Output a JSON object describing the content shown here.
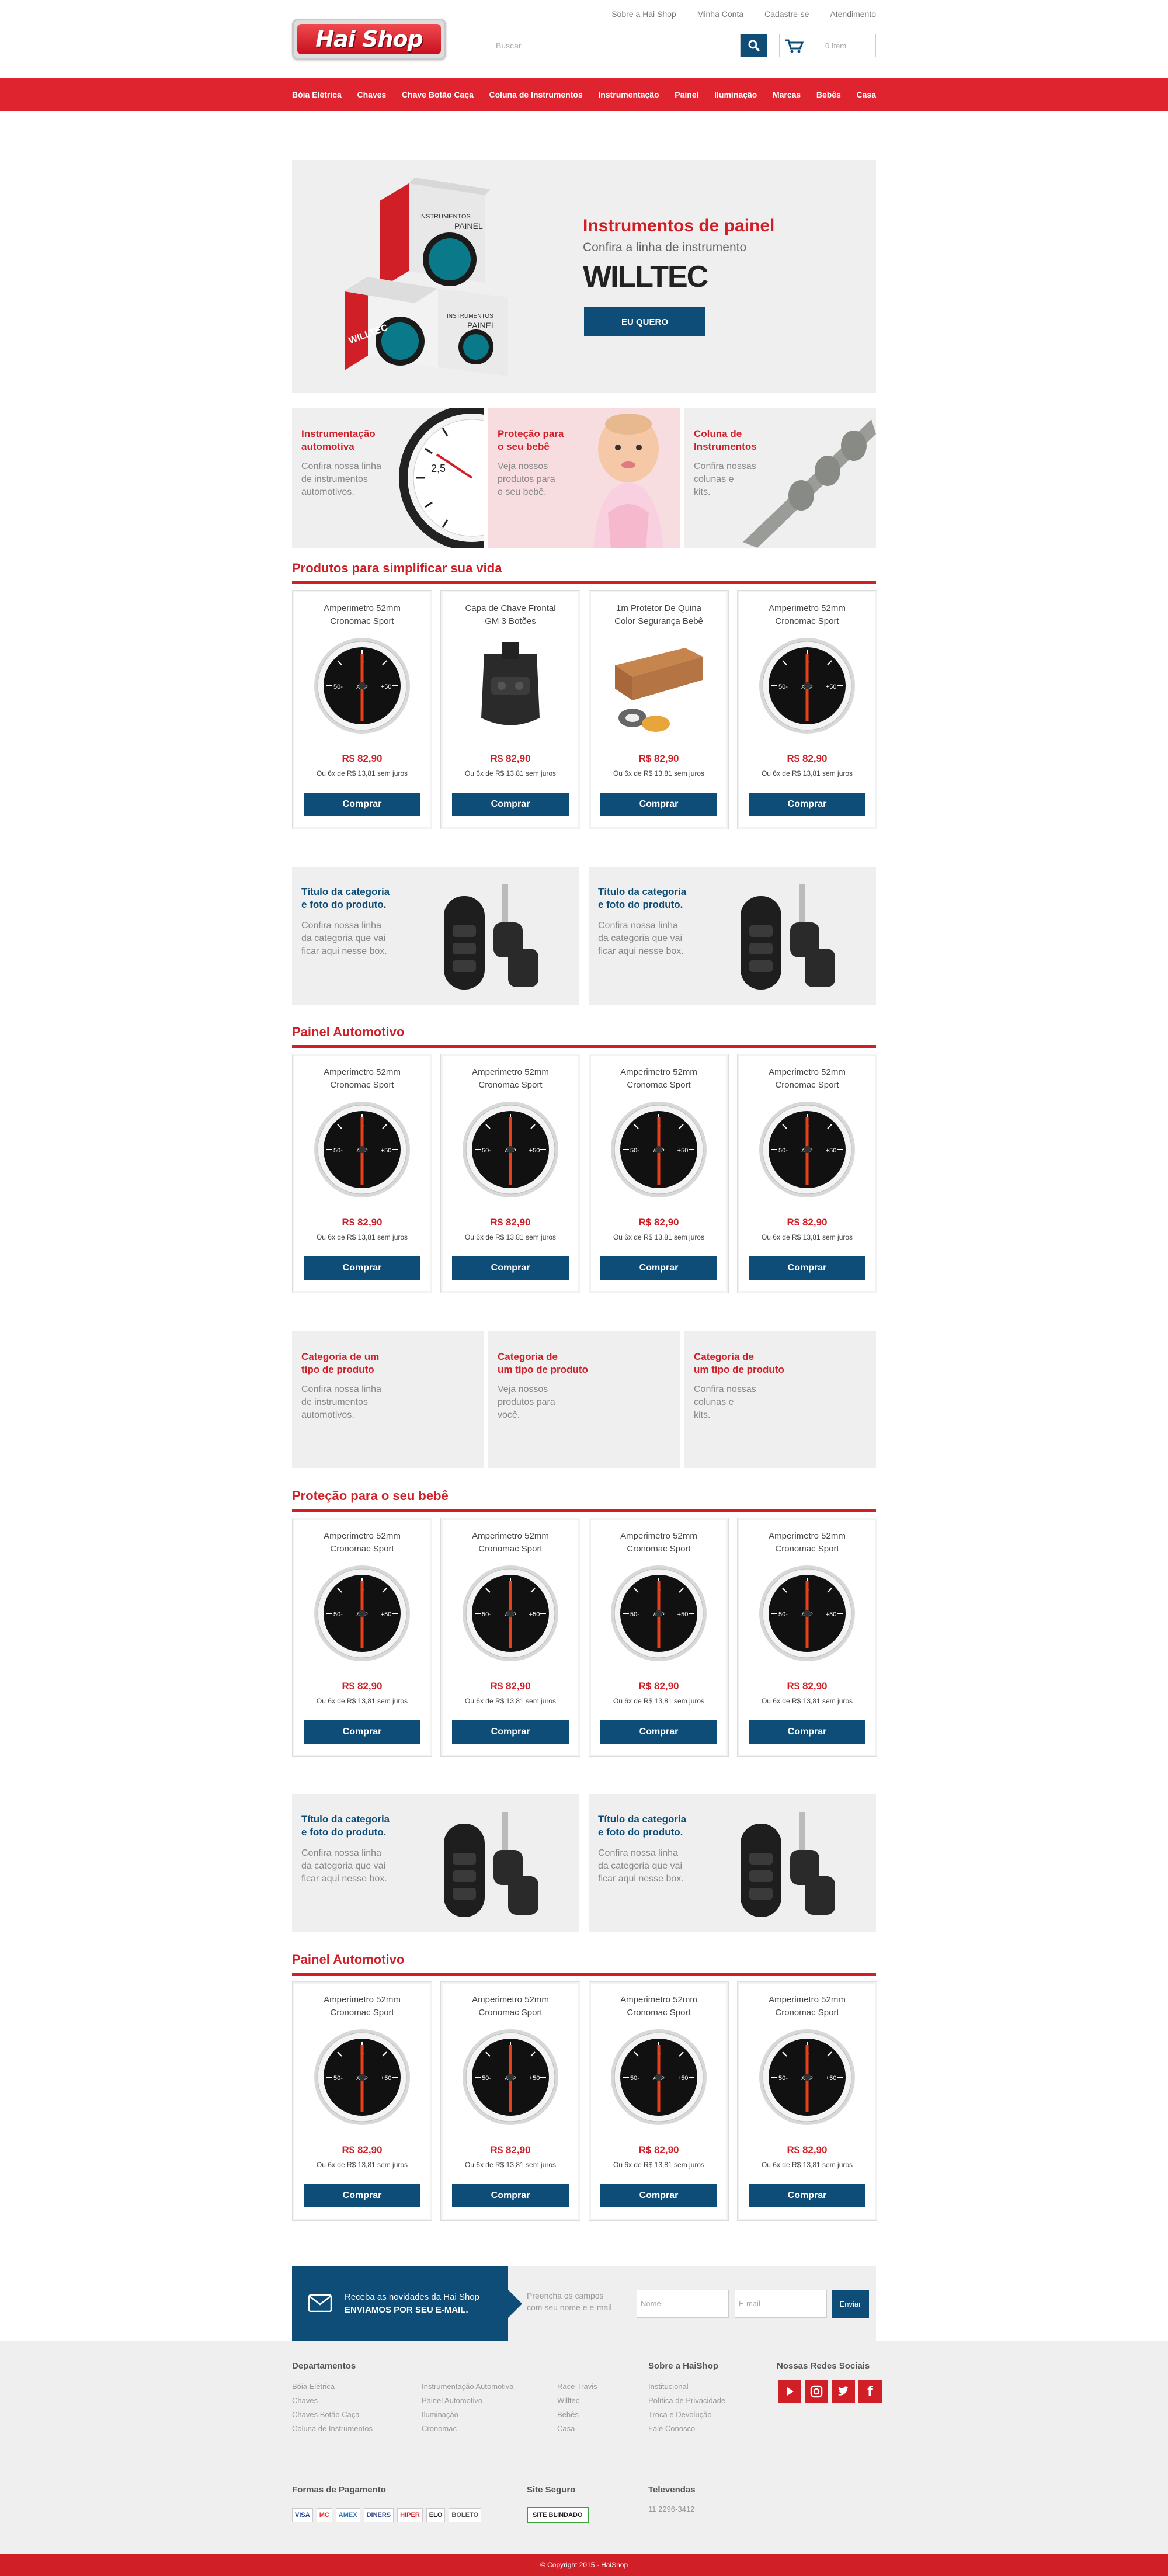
{
  "header": {
    "logo_text": "Hai Shop",
    "top_links": [
      "Sobre a Hai Shop",
      "Minha Conta",
      "Cadastre-se",
      "Atendimento"
    ],
    "search_placeholder": "Buscar",
    "cart_count": "0 Item"
  },
  "nav": [
    "Bóia Elétrica",
    "Chaves",
    "Chave Botão Caça",
    "Coluna de Instrumentos",
    "Instrumentação",
    "Painel",
    "Iluminação",
    "Marcas",
    "Bebês",
    "Casa"
  ],
  "banner": {
    "title": "Instrumentos de painel",
    "subtitle": "Confira a linha de instrumento",
    "brand": "WILLTEC",
    "button": "EU QUERO",
    "box_text": "INSTRUMENTOS DE PAINEL"
  },
  "promos": [
    {
      "title": "Instrumentação\nautomotiva",
      "desc": "Confira nossa linha\nde instrumentos\nautomotivos."
    },
    {
      "title": "Proteção para\no seu bebê",
      "desc": "Veja nossos\nprodutos para\no seu bebê."
    },
    {
      "title": "Coluna de\nInstrumentos",
      "desc": "Confira nossas\ncolunas e\nkits."
    }
  ],
  "sections": [
    "Produtos para simplificar sua vida",
    "Painel Automotivo",
    "Proteção para o seu bebê",
    "Painel Automotivo"
  ],
  "product_rows": [
    [
      {
        "name": "Amperimetro 52mm\nCronomac Sport",
        "price": "R$ 82,90",
        "installments": "Ou 6x de R$ 13,81 sem juros",
        "button": "Comprar",
        "image": "gauge"
      },
      {
        "name": "Capa de Chave Frontal\nGM 3 Botões",
        "price": "R$ 82,90",
        "installments": "Ou 6x de R$ 13,81 sem juros",
        "button": "Comprar",
        "image": "keycover"
      },
      {
        "name": "1m Protetor De Quina\nColor Segurança Bebê",
        "price": "R$ 82,90",
        "installments": "Ou 6x de R$ 13,81 sem juros",
        "button": "Comprar",
        "image": "protector"
      },
      {
        "name": "Amperimetro 52mm\nCronomac Sport",
        "price": "R$ 82,90",
        "installments": "Ou 6x de R$ 13,81 sem juros",
        "button": "Comprar",
        "image": "gauge"
      }
    ],
    [
      {
        "name": "Amperimetro 52mm\nCronomac Sport",
        "price": "R$ 82,90",
        "installments": "Ou 6x de R$ 13,81 sem juros",
        "button": "Comprar",
        "image": "gauge"
      },
      {
        "name": "Amperimetro 52mm\nCronomac Sport",
        "price": "R$ 82,90",
        "installments": "Ou 6x de R$ 13,81 sem juros",
        "button": "Comprar",
        "image": "gauge"
      },
      {
        "name": "Amperimetro 52mm\nCronomac Sport",
        "price": "R$ 82,90",
        "installments": "Ou 6x de R$ 13,81 sem juros",
        "button": "Comprar",
        "image": "gauge"
      },
      {
        "name": "Amperimetro 52mm\nCronomac Sport",
        "price": "R$ 82,90",
        "installments": "Ou 6x de R$ 13,81 sem juros",
        "button": "Comprar",
        "image": "gauge"
      }
    ],
    [
      {
        "name": "Amperimetro 52mm\nCronomac Sport",
        "price": "R$ 82,90",
        "installments": "Ou 6x de R$ 13,81 sem juros",
        "button": "Comprar",
        "image": "gauge"
      },
      {
        "name": "Amperimetro 52mm\nCronomac Sport",
        "price": "R$ 82,90",
        "installments": "Ou 6x de R$ 13,81 sem juros",
        "button": "Comprar",
        "image": "gauge"
      },
      {
        "name": "Amperimetro 52mm\nCronomac Sport",
        "price": "R$ 82,90",
        "installments": "Ou 6x de R$ 13,81 sem juros",
        "button": "Comprar",
        "image": "gauge"
      },
      {
        "name": "Amperimetro 52mm\nCronomac Sport",
        "price": "R$ 82,90",
        "installments": "Ou 6x de R$ 13,81 sem juros",
        "button": "Comprar",
        "image": "gauge"
      }
    ],
    [
      {
        "name": "Amperimetro 52mm\nCronomac Sport",
        "price": "R$ 82,90",
        "installments": "Ou 6x de R$ 13,81 sem juros",
        "button": "Comprar",
        "image": "gauge"
      },
      {
        "name": "Amperimetro 52mm\nCronomac Sport",
        "price": "R$ 82,90",
        "installments": "Ou 6x de R$ 13,81 sem juros",
        "button": "Comprar",
        "image": "gauge"
      },
      {
        "name": "Amperimetro 52mm\nCronomac Sport",
        "price": "R$ 82,90",
        "installments": "Ou 6x de R$ 13,81 sem juros",
        "button": "Comprar",
        "image": "gauge"
      },
      {
        "name": "Amperimetro 52mm\nCronomac Sport",
        "price": "R$ 82,90",
        "installments": "Ou 6x de R$ 13,81 sem juros",
        "button": "Comprar",
        "image": "gauge"
      }
    ]
  ],
  "category_pairs": [
    {
      "title": "Título da categoria\ne foto do produto.",
      "desc": "Confira nossa linha\nda categoria que vai\nficar aqui nesse box."
    },
    {
      "title": "Título da categoria\ne foto do produto.",
      "desc": "Confira nossa linha\nda categoria que vai\nficar aqui nesse box."
    }
  ],
  "category_triples": [
    {
      "title": "Categoria de um\ntipo de produto",
      "desc": "Confira nossa linha\nde instrumentos\nautomotivos."
    },
    {
      "title": "Categoria de\num tipo de produto",
      "desc": "Veja nossos\nprodutos para\nvocê."
    },
    {
      "title": "Categoria de\num tipo de produto",
      "desc": "Confira nossas\ncolunas e\nkits."
    }
  ],
  "gauge": {
    "top": "0",
    "left": "50-",
    "right": "+50",
    "center": "AMP"
  },
  "newsletter": {
    "line1": "Receba as novidades da Hai Shop",
    "line2": "ENVIAMOS POR SEU E-MAIL.",
    "hint": "Preencha os campos\ncom seu nome e e-mail",
    "name_placeholder": "Nome",
    "email_placeholder": "E-mail",
    "button": "Enviar"
  },
  "footer": {
    "departments_title": "Departamentos",
    "departments_col1": [
      "Bóia Elétrica",
      "Chaves",
      "Chaves Botão Caça",
      "Coluna de Instrumentos"
    ],
    "departments_col2": [
      "Instrumentação Automotiva",
      "Painel Automotivo",
      "Iluminação",
      "Cronomac"
    ],
    "departments_col3": [
      "Race Travis",
      "Willtec",
      "Bebês",
      "Casa"
    ],
    "about_title": "Sobre a HaiShop",
    "about_links": [
      "Institucional",
      "Política de Privacidade",
      "Troca e Devolução",
      "Fale Conosco"
    ],
    "social_title": "Nossas Redes Sociais",
    "payment_title": "Formas de Pagamento",
    "payments": [
      "VISA",
      "MC",
      "AMEX",
      "DINERS",
      "HIPER",
      "ELO",
      "BOLETO"
    ],
    "secure_title": "Site Seguro",
    "secure_badge": "SITE BLINDADO",
    "phone_title": "Televendas",
    "phone": "11 2296-3412",
    "copyright": "© Copyright 2015 - HaiShop"
  },
  "colors": {
    "red": "#d11f28",
    "blue": "#0e4d78",
    "gray": "#efefef"
  }
}
